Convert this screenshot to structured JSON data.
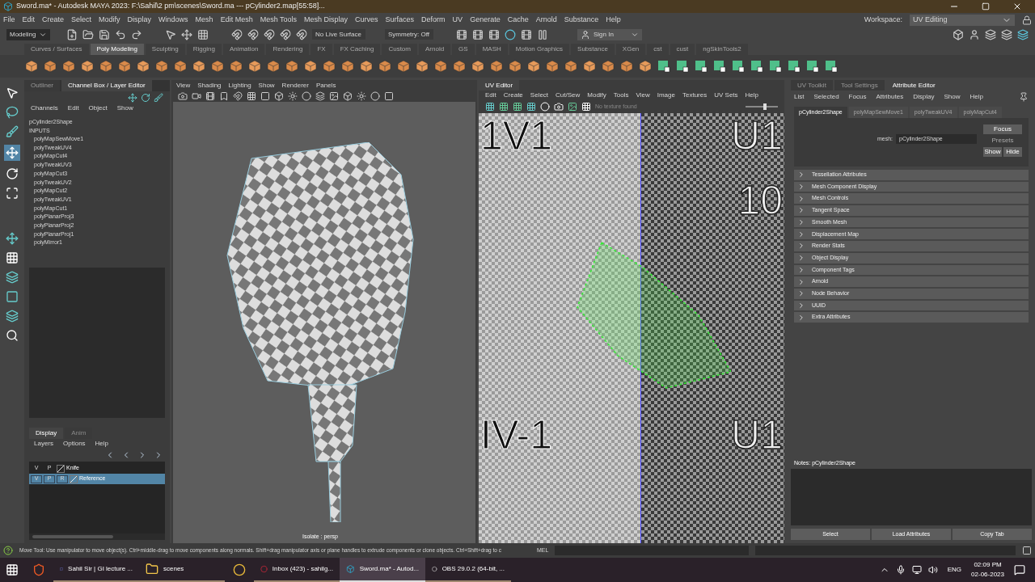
{
  "window": {
    "title": "Sword.ma* - Autodesk MAYA 2023: F:\\Sahil\\2 pm\\scenes\\Sword.ma  ---  pCylinder2.map[55:58]..."
  },
  "menu_bar": [
    "File",
    "Edit",
    "Create",
    "Select",
    "Modify",
    "Display",
    "Windows",
    "Mesh",
    "Edit Mesh",
    "Mesh Tools",
    "Mesh Display",
    "Curves",
    "Surfaces",
    "Deform",
    "UV",
    "Generate",
    "Cache",
    "Arnold",
    "Substance",
    "Help"
  ],
  "workspace": {
    "label": "Workspace:",
    "value": "UV Editing"
  },
  "status_line": {
    "mode": "Modeling",
    "live_surface": "No Live Surface",
    "symmetry": "Symmetry: Off",
    "sign_in": "Sign In"
  },
  "shelf_tabs": [
    {
      "label": "Curves / Surfaces",
      "selected": false
    },
    {
      "label": "Poly Modeling",
      "selected": true
    },
    {
      "label": "Sculpting",
      "selected": false
    },
    {
      "label": "Rigging",
      "selected": false
    },
    {
      "label": "Animation",
      "selected": false
    },
    {
      "label": "Rendering",
      "selected": false
    },
    {
      "label": "FX",
      "selected": false
    },
    {
      "label": "FX Caching",
      "selected": false
    },
    {
      "label": "Custom",
      "selected": false
    },
    {
      "label": "Arnold",
      "selected": false
    },
    {
      "label": "GS",
      "selected": false
    },
    {
      "label": "MASH",
      "selected": false
    },
    {
      "label": "Motion Graphics",
      "selected": false
    },
    {
      "label": "Substance",
      "selected": false
    },
    {
      "label": "XGen",
      "selected": false
    },
    {
      "label": "cst",
      "selected": false
    },
    {
      "label": "cust",
      "selected": false
    },
    {
      "label": "ngSkinTools2",
      "selected": false
    }
  ],
  "channel_panel": {
    "tabs": [
      {
        "label": "Outliner",
        "selected": false
      },
      {
        "label": "Channel Box / Layer Editor",
        "selected": true
      }
    ],
    "menu": [
      "Channels",
      "Edit",
      "Object",
      "Show"
    ],
    "shape": "pCylinder2Shape",
    "inputs_label": "INPUTS",
    "inputs": [
      "polyMapSewMove1",
      "polyTweakUV4",
      "polyMapCut4",
      "polyTweakUV3",
      "polyMapCut3",
      "polyTweakUV2",
      "polyMapCut2",
      "polyTweakUV1",
      "polyMapCut1",
      "polyPlanarProj3",
      "polyPlanarProj2",
      "polyPlanarProj1",
      "polyMirror1"
    ]
  },
  "layer_editor": {
    "tabs": [
      {
        "label": "Display",
        "selected": true
      },
      {
        "label": "Anim",
        "selected": false
      }
    ],
    "menu": [
      "Layers",
      "Options",
      "Help"
    ],
    "layers": [
      {
        "name": "Knife",
        "flags": [
          "V",
          "P"
        ],
        "selected": false
      },
      {
        "name": "Reference",
        "flags": [
          "V",
          "P",
          "R"
        ],
        "selected": true
      }
    ]
  },
  "viewport": {
    "menu": [
      "View",
      "Shading",
      "Lighting",
      "Show",
      "Renderer",
      "Panels"
    ],
    "camera_label": "Isolate : persp"
  },
  "uv_editor": {
    "title": "UV Editor",
    "menu": [
      "Edit",
      "Create",
      "Select",
      "Cut/Sew",
      "Modify",
      "Tools",
      "View",
      "Image",
      "Textures",
      "UV Sets",
      "Help"
    ],
    "texture_status": "No texture found",
    "tile_labels": [
      "1V1",
      "U1",
      "10",
      "IV-1",
      "U1"
    ],
    "slider": {
      "level": 0.6
    }
  },
  "attribute_editor": {
    "tabs": [
      {
        "label": "UV Toolkit",
        "selected": false
      },
      {
        "label": "Tool Settings",
        "selected": false
      },
      {
        "label": "Attribute Editor",
        "selected": true
      }
    ],
    "menu": [
      "List",
      "Selected",
      "Focus",
      "Attributes",
      "Display",
      "Show",
      "Help"
    ],
    "node_tabs": [
      {
        "label": "pCylinder2Shape",
        "selected": true
      },
      {
        "label": "polyMapSewMove1",
        "selected": false
      },
      {
        "label": "polyTweakUV4",
        "selected": false
      },
      {
        "label": "polyMapCut4",
        "selected": false
      }
    ],
    "mesh_label": "mesh:",
    "mesh_value": "pCylinder2Shape",
    "side_buttons": [
      {
        "label": "Focus",
        "disabled": false
      },
      {
        "label": "Presets",
        "disabled": true
      },
      {
        "label": "Show",
        "disabled": false
      },
      {
        "label": "Hide",
        "disabled": false
      }
    ],
    "sections": [
      {
        "label": "Tessellation Attributes",
        "expanded": false
      },
      {
        "label": "Mesh Component Display",
        "expanded": false
      },
      {
        "label": "Mesh Controls",
        "expanded": false
      },
      {
        "label": "Tangent Space",
        "expanded": false
      },
      {
        "label": "Smooth Mesh",
        "expanded": false
      },
      {
        "label": "Displacement Map",
        "expanded": false
      },
      {
        "label": "Render Stats",
        "expanded": false
      },
      {
        "label": "Object Display",
        "expanded": false
      },
      {
        "label": "Component Tags",
        "expanded": false
      },
      {
        "label": "Arnold",
        "expanded": false
      },
      {
        "label": "Node Behavior",
        "expanded": false
      },
      {
        "label": "UUID",
        "expanded": false
      },
      {
        "label": "Extra Attributes",
        "expanded": false
      }
    ],
    "notes_label": "Notes:  pCylinder2Shape",
    "buttons": [
      "Select",
      "Load Attributes",
      "Copy Tab"
    ]
  },
  "help_line": "Move Tool: Use manipulator to move object(s). Ctrl+middle-drag to move components along normals. Shift+drag manipulator axis or plane handles to extrude components or clone objects. Ctrl+Shift+drag to c",
  "command_line": {
    "label": "MEL"
  },
  "taskbar": {
    "items": [
      {
        "kind": "browser-lion"
      },
      {
        "kind": "chat",
        "label": "Sahil Sir | GI lecture ...",
        "selected": false
      },
      {
        "kind": "folder",
        "label": "scenes",
        "selected": false
      },
      {
        "kind": "browser-circle"
      },
      {
        "kind": "mail",
        "label": "Inbox (423) - sahilg...",
        "selected": false
      },
      {
        "kind": "maya",
        "label": "Sword.ma* - Autod...",
        "selected": true
      },
      {
        "kind": "recorder",
        "label": "OBS 29.0.2 (64-bit, ...",
        "selected": false
      }
    ],
    "language": "ENG",
    "time": "02:09 PM",
    "date": "02-06-2023"
  }
}
